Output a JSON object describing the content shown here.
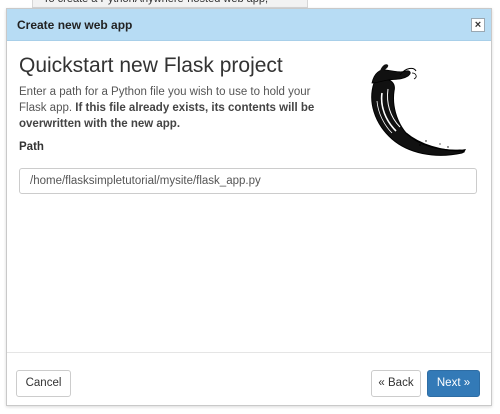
{
  "background": {
    "snippet_text": "To create a PythonAnywhere-hosted web app,"
  },
  "dialog": {
    "title": "Create new web app",
    "close_label": "×",
    "heading": "Quickstart new Flask project",
    "description_plain": "Enter a path for a Python file you wish to use to hold your Flask app.",
    "description_bold": "If this file already exists, its contents will be overwritten with the new app.",
    "path_label": "Path",
    "path_value": "/home/flasksimpletutorial/mysite/flask_app.py",
    "logo_icon": "flask-horn-logo"
  },
  "footer": {
    "cancel_label": "Cancel",
    "back_label": "« Back",
    "next_label": "Next »"
  },
  "colors": {
    "header_bg": "#b7dcf4",
    "primary_button": "#337ab7",
    "border": "#cccccc"
  }
}
